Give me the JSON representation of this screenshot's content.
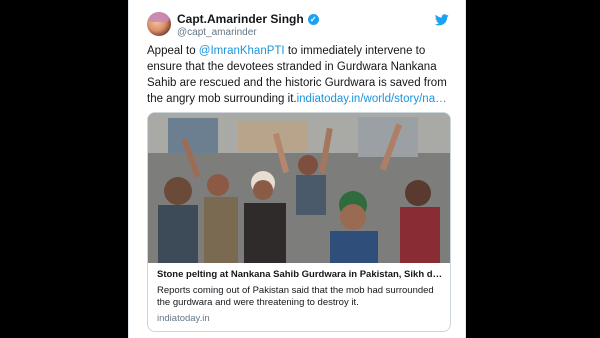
{
  "tweet": {
    "author_name": "Capt.Amarinder Singh",
    "handle": "@capt_amarinder",
    "verified_glyph": "✓",
    "text_lead": "Appeal to ",
    "mention": "@ImranKhanPTI",
    "text_body": " to immediately intervene to ensure that the devotees stranded in Gurdwara Nankana Sahib are rescued and the historic Gurdwara is saved from the angry mob surrounding it.",
    "link_text": "indiatoday.in/world/story/na…"
  },
  "card": {
    "title": "Stone pelting at Nankana Sahib Gurdwara in Pakistan, Sikh de…",
    "description": "Reports coming out of Pakistan said that the mob had surrounded the gurdwara and were threatening to destroy it.",
    "domain": "indiatoday.in"
  },
  "colors": {
    "background": "#000000",
    "card_border": "#ccd6dd",
    "link": "#1b95e0",
    "verified": "#1da1f2"
  },
  "icons": [
    "verified-badge-icon",
    "twitter-bird-icon"
  ]
}
